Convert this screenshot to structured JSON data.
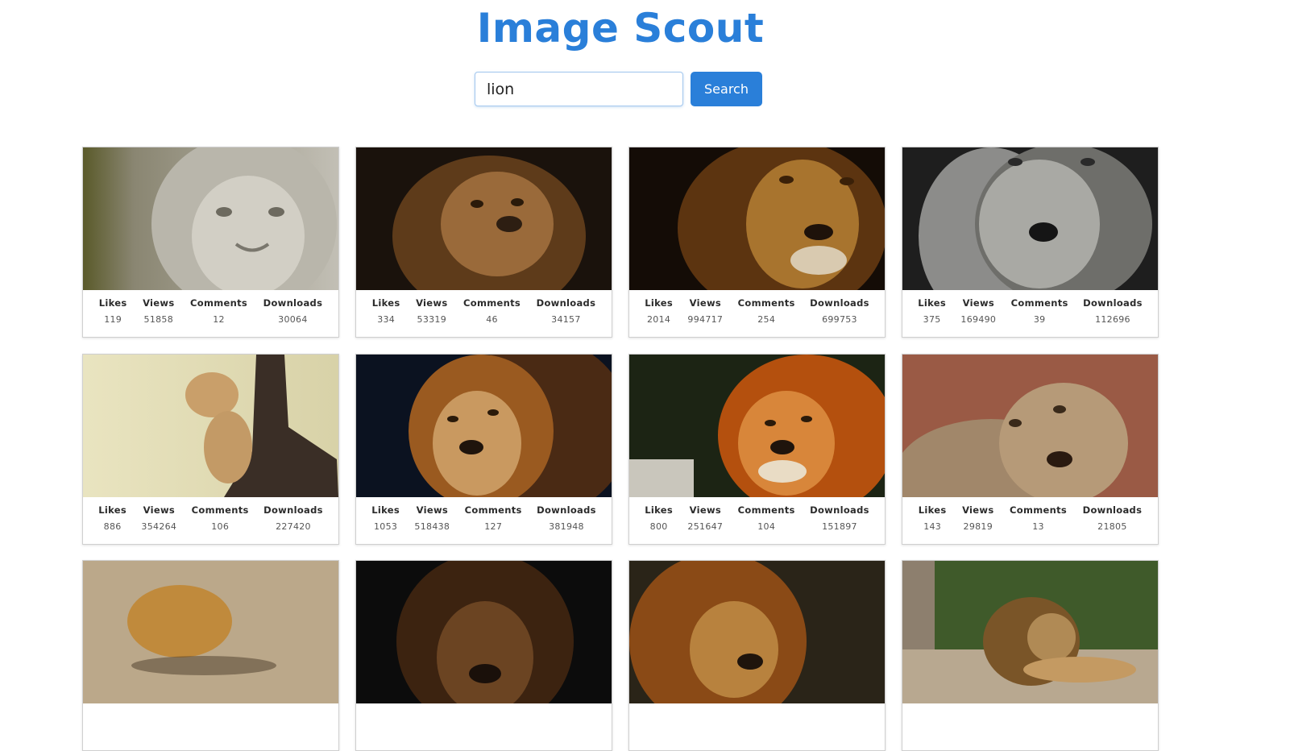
{
  "app": {
    "title": "Image Scout"
  },
  "search": {
    "value": "lion",
    "button_label": "Search"
  },
  "stat_labels": {
    "likes": "Likes",
    "views": "Views",
    "comments": "Comments",
    "downloads": "Downloads"
  },
  "cards": [
    {
      "likes": "119",
      "views": "51858",
      "comments": "12",
      "downloads": "30064"
    },
    {
      "likes": "334",
      "views": "53319",
      "comments": "46",
      "downloads": "34157"
    },
    {
      "likes": "2014",
      "views": "994717",
      "comments": "254",
      "downloads": "699753"
    },
    {
      "likes": "375",
      "views": "169490",
      "comments": "39",
      "downloads": "112696"
    },
    {
      "likes": "886",
      "views": "354264",
      "comments": "106",
      "downloads": "227420"
    },
    {
      "likes": "1053",
      "views": "518438",
      "comments": "127",
      "downloads": "381948"
    },
    {
      "likes": "800",
      "views": "251647",
      "comments": "104",
      "downloads": "151897"
    },
    {
      "likes": "143",
      "views": "29819",
      "comments": "13",
      "downloads": "21805"
    },
    {},
    {},
    {},
    {}
  ],
  "colors": {
    "accent": "#2a7fd9"
  }
}
